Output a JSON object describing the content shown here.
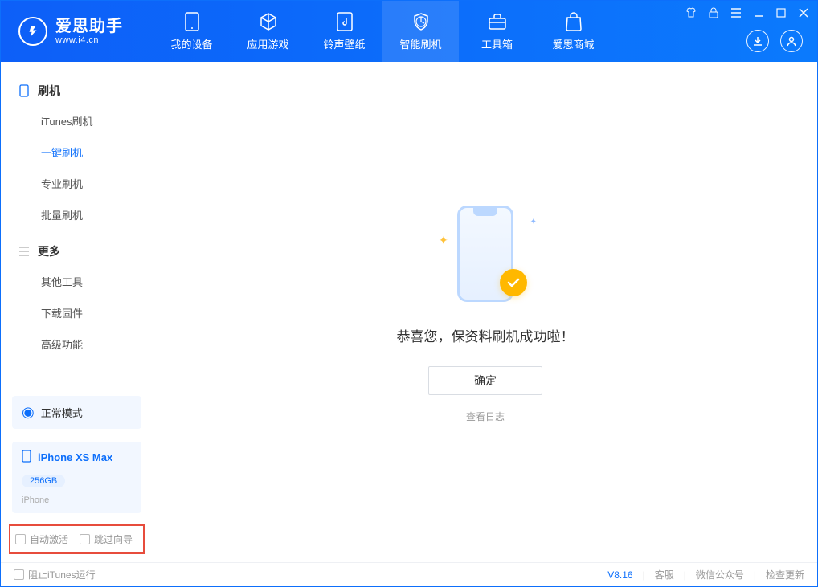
{
  "app": {
    "name_cn": "爱思助手",
    "name_en": "www.i4.cn"
  },
  "nav": {
    "device": "我的设备",
    "apps": "应用游戏",
    "ringtone": "铃声壁纸",
    "flash": "智能刷机",
    "tools": "工具箱",
    "store": "爱思商城"
  },
  "sidebar": {
    "group_flash": "刷机",
    "items_flash": {
      "itunes": "iTunes刷机",
      "onekey": "一键刷机",
      "pro": "专业刷机",
      "batch": "批量刷机"
    },
    "group_more": "更多",
    "items_more": {
      "other": "其他工具",
      "firmware": "下载固件",
      "advanced": "高级功能"
    },
    "mode_label": "正常模式",
    "device_name": "iPhone XS Max",
    "device_capacity": "256GB",
    "device_type": "iPhone",
    "auto_activate": "自动激活",
    "skip_guide": "跳过向导"
  },
  "main": {
    "success_text": "恭喜您，保资料刷机成功啦！",
    "ok_label": "确定",
    "log_label": "查看日志"
  },
  "footer": {
    "block_itunes": "阻止iTunes运行",
    "version": "V8.16",
    "kefu": "客服",
    "wechat": "微信公众号",
    "update": "检查更新"
  }
}
